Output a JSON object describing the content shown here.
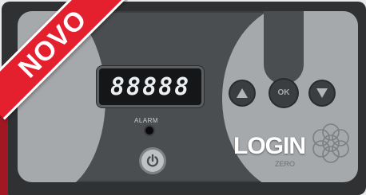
{
  "ribbon": {
    "text": "NOVO"
  },
  "controller": {
    "display_digits": "88888",
    "alarm_label": "ALARM",
    "ok_label": "OK",
    "brand_logo": "LOGIN",
    "brand_sub": "ZERO"
  },
  "colors": {
    "ribbon": "#e5202e",
    "panel": "#4b4e51",
    "panel_accent": "#a6a9ac"
  },
  "icons": [
    "power-icon",
    "up-arrow-icon",
    "down-arrow-icon",
    "logo-rosette-icon"
  ]
}
